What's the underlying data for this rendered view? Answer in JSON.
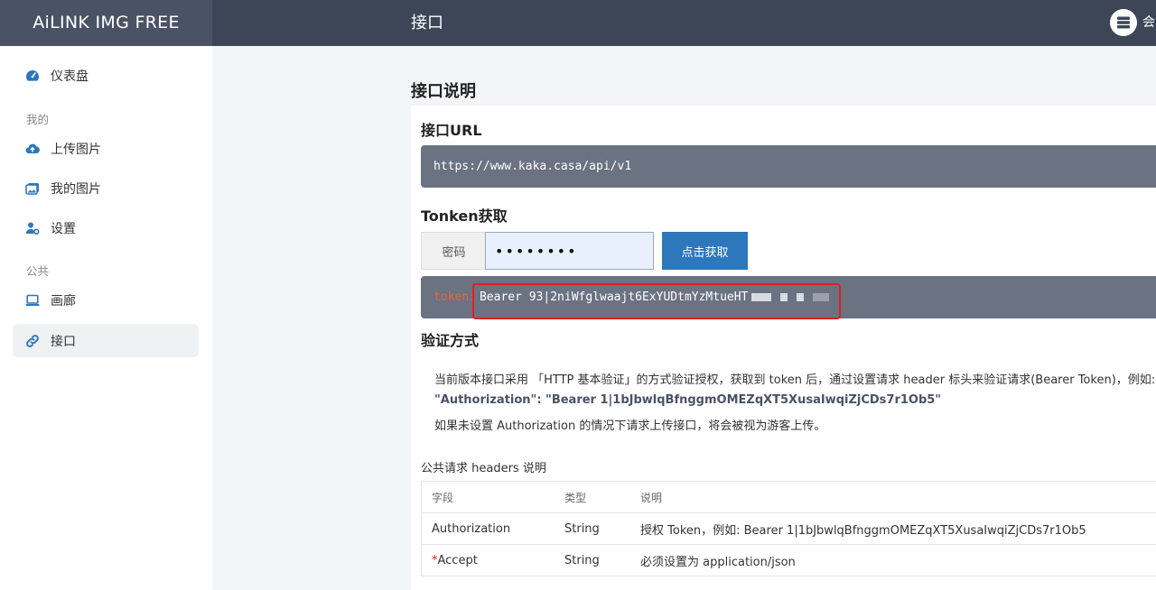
{
  "app": {
    "brand": "AiLINK IMG FREE",
    "page_heading": "接口",
    "user_name": "会"
  },
  "sidebar": {
    "items": [
      {
        "label": "仪表盘"
      },
      {
        "label": "上传图片"
      },
      {
        "label": "我的图片"
      },
      {
        "label": "设置"
      },
      {
        "label": "画廊"
      },
      {
        "label": "接口"
      }
    ],
    "sections": [
      "我的",
      "公共"
    ],
    "active": "接口"
  },
  "main": {
    "section_title": "接口说明",
    "api_url": {
      "title": "接口URL",
      "value": "https://www.kaka.casa/api/v1"
    },
    "token": {
      "title": "Tonken获取",
      "password_label": "密码",
      "password_value": "••••••••",
      "fetch_button": "点击获取",
      "token_key": "token:",
      "token_value": "Bearer 93|2niWfglwaajt6ExYUDtmYzMtueHT"
    },
    "auth": {
      "title": "验证方式",
      "line1": "当前版本接口采用 「HTTP 基本验证」的方式验证授权，获取到 token 后，通过设置请求 header 标头来验证请求(Bearer Token)，例如:",
      "line2": "\"Authorization\": \"Bearer 1|1bJbwlqBfnggmOMEZqXT5XusaIwqiZjCDs7r1Ob5\"",
      "line3": "如果未设置 Authorization 的情况下请求上传接口，将会被视为游客上传。"
    },
    "headers": {
      "title": "公共请求 headers 说明",
      "columns": [
        "字段",
        "类型",
        "说明"
      ],
      "rows": [
        {
          "field": "Authorization",
          "required": "",
          "type": "String",
          "desc": "授权 Token，例如: Bearer 1|1bJbwlqBfnggmOMEZqXT5XusaIwqiZjCDs7r1Ob5"
        },
        {
          "field": "Accept",
          "required": "*",
          "type": "String",
          "desc": "必须设置为 application/json"
        }
      ]
    }
  },
  "colors": {
    "topbar": "#3c4657",
    "accent": "#2d77bd",
    "code_bg": "#6b7281",
    "highlight": "#e02020",
    "token_key": "#e8663c"
  }
}
